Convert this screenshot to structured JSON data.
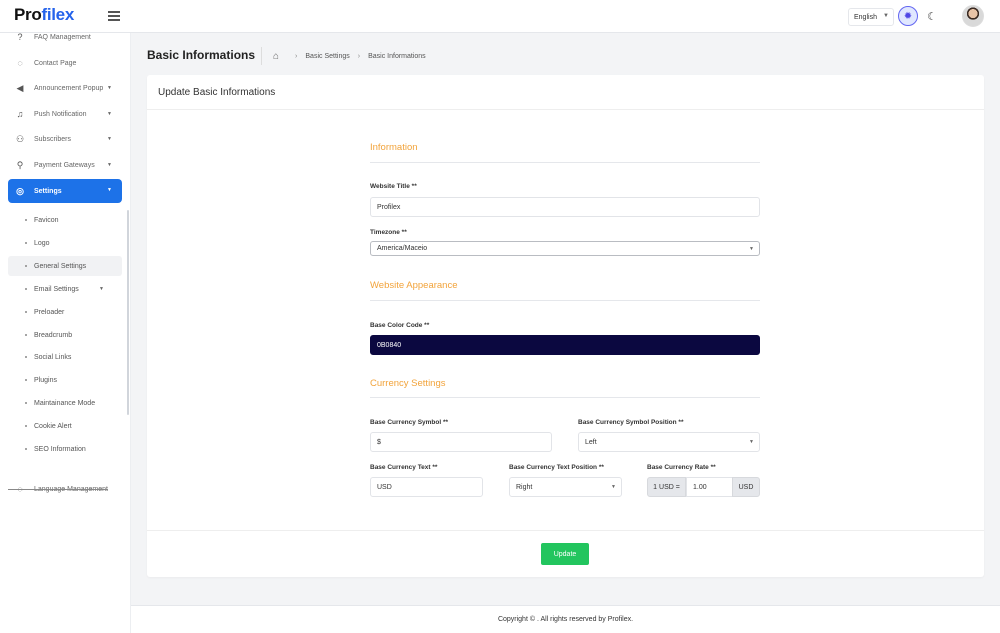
{
  "brand": {
    "name_part1": "Pro",
    "name_part2": "filex"
  },
  "topbar": {
    "language": "English"
  },
  "sidebar": {
    "items": [
      {
        "label": "FAQ Management",
        "icon": "help-circle-icon"
      },
      {
        "label": "Contact Page",
        "icon": "whatsapp-icon"
      },
      {
        "label": "Announcement Popup",
        "icon": "megaphone-icon"
      },
      {
        "label": "Push Notification",
        "icon": "bell-icon"
      },
      {
        "label": "Subscribers",
        "icon": "users-icon"
      },
      {
        "label": "Payment Gateways",
        "icon": "search-dollar-icon"
      },
      {
        "label": "Settings",
        "icon": "gear-icon"
      }
    ],
    "sub_items": [
      "Favicon",
      "Logo",
      "General Settings",
      "Email Settings",
      "Preloader",
      "Breadcrumb",
      "Social Links",
      "Plugins",
      "Maintainance Mode",
      "Cookie Alert",
      "SEO Information"
    ],
    "last_item": "Language Management"
  },
  "page": {
    "title": "Basic Informations",
    "breadcrumb": [
      "Basic Settings",
      "Basic Informations"
    ]
  },
  "card": {
    "header": "Update Basic Informations",
    "sections": {
      "information": "Information",
      "appearance": "Website Appearance",
      "currency": "Currency Settings"
    },
    "fields": {
      "website_title": {
        "label": "Website Title **",
        "value": "Profilex"
      },
      "timezone": {
        "label": "Timezone **",
        "value": "America/Maceio"
      },
      "base_color": {
        "label": "Base Color Code **",
        "value": "0B0840"
      },
      "currency_symbol": {
        "label": "Base Currency Symbol **",
        "value": "$"
      },
      "currency_symbol_position": {
        "label": "Base Currency Symbol Position **",
        "value": "Left"
      },
      "currency_text": {
        "label": "Base Currency Text **",
        "value": "USD"
      },
      "currency_text_position": {
        "label": "Base Currency Text Position **",
        "value": "Right"
      },
      "currency_rate": {
        "label": "Base Currency Rate **",
        "prefix": "1 USD =",
        "value": "1.00",
        "suffix": "USD"
      }
    },
    "submit": "Update"
  },
  "footer": {
    "text": "Copyright © . All rights reserved by Profilex."
  },
  "colors": {
    "primary": "#1d72e8",
    "accent": "#f2a33a",
    "success": "#22c55e",
    "base": "#0b0840"
  }
}
